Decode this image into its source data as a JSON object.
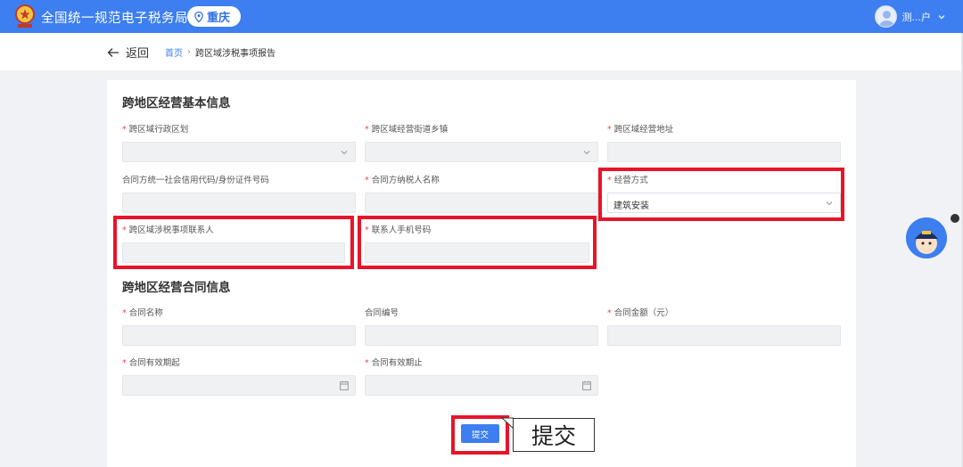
{
  "header": {
    "title": "全国统一规范电子税务局",
    "region": "重庆",
    "user_name": "测...户"
  },
  "nav": {
    "back_label": "返回",
    "breadcrumb_home": "首页",
    "breadcrumb_sep": "›",
    "breadcrumb_current": "跨区域涉税事项报告"
  },
  "form": {
    "section1_title": "跨地区经营基本信息",
    "section2_title": "跨地区经营合同信息",
    "required_mark": "*",
    "fields": {
      "admin_region": "跨区域行政区划",
      "street_town": "跨区域经营街道乡镇",
      "business_address": "跨区域经营地址",
      "party_credit_code": "合同方统一社会信用代码/身份证件号码",
      "party_taxpayer_name": "合同方纳税人名称",
      "business_mode": "经营方式",
      "business_mode_value": "建筑安装",
      "contact_person": "跨区域涉税事项联系人",
      "contact_phone": "联系人手机号码",
      "contract_name": "合同名称",
      "contract_number": "合同编号",
      "contract_amount": "合同金额（元）",
      "valid_from": "合同有效期起",
      "valid_to": "合同有效期止"
    },
    "submit_label": "提交",
    "callout_text": "提交"
  },
  "colors": {
    "primary": "#3d7ef0",
    "highlight": "#e8142a",
    "required": "#f04b4b"
  }
}
